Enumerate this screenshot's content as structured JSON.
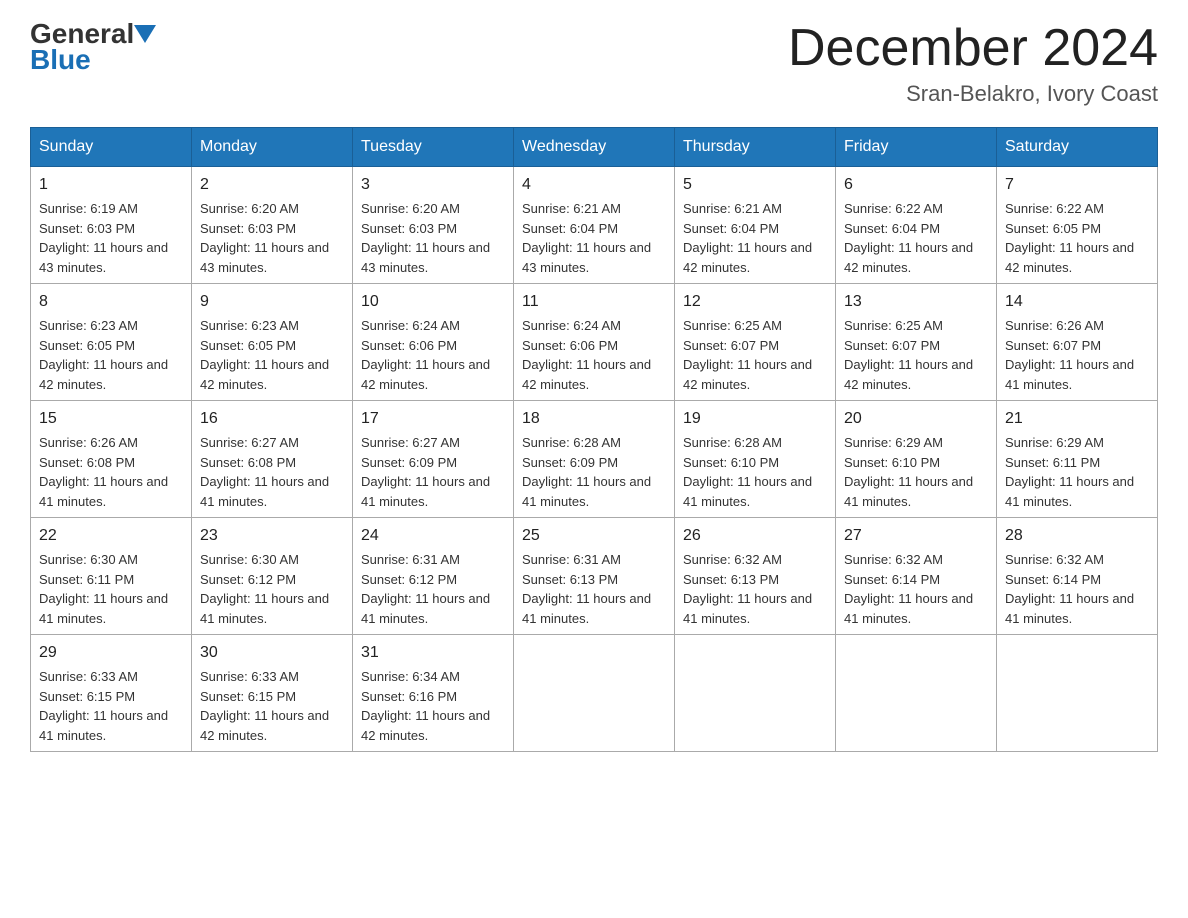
{
  "logo": {
    "part1": "General",
    "part2": "Blue"
  },
  "title": "December 2024",
  "location": "Sran-Belakro, Ivory Coast",
  "days_of_week": [
    "Sunday",
    "Monday",
    "Tuesday",
    "Wednesday",
    "Thursday",
    "Friday",
    "Saturday"
  ],
  "weeks": [
    [
      {
        "day": "1",
        "sunrise": "6:19 AM",
        "sunset": "6:03 PM",
        "daylight": "11 hours and 43 minutes."
      },
      {
        "day": "2",
        "sunrise": "6:20 AM",
        "sunset": "6:03 PM",
        "daylight": "11 hours and 43 minutes."
      },
      {
        "day": "3",
        "sunrise": "6:20 AM",
        "sunset": "6:03 PM",
        "daylight": "11 hours and 43 minutes."
      },
      {
        "day": "4",
        "sunrise": "6:21 AM",
        "sunset": "6:04 PM",
        "daylight": "11 hours and 43 minutes."
      },
      {
        "day": "5",
        "sunrise": "6:21 AM",
        "sunset": "6:04 PM",
        "daylight": "11 hours and 42 minutes."
      },
      {
        "day": "6",
        "sunrise": "6:22 AM",
        "sunset": "6:04 PM",
        "daylight": "11 hours and 42 minutes."
      },
      {
        "day": "7",
        "sunrise": "6:22 AM",
        "sunset": "6:05 PM",
        "daylight": "11 hours and 42 minutes."
      }
    ],
    [
      {
        "day": "8",
        "sunrise": "6:23 AM",
        "sunset": "6:05 PM",
        "daylight": "11 hours and 42 minutes."
      },
      {
        "day": "9",
        "sunrise": "6:23 AM",
        "sunset": "6:05 PM",
        "daylight": "11 hours and 42 minutes."
      },
      {
        "day": "10",
        "sunrise": "6:24 AM",
        "sunset": "6:06 PM",
        "daylight": "11 hours and 42 minutes."
      },
      {
        "day": "11",
        "sunrise": "6:24 AM",
        "sunset": "6:06 PM",
        "daylight": "11 hours and 42 minutes."
      },
      {
        "day": "12",
        "sunrise": "6:25 AM",
        "sunset": "6:07 PM",
        "daylight": "11 hours and 42 minutes."
      },
      {
        "day": "13",
        "sunrise": "6:25 AM",
        "sunset": "6:07 PM",
        "daylight": "11 hours and 42 minutes."
      },
      {
        "day": "14",
        "sunrise": "6:26 AM",
        "sunset": "6:07 PM",
        "daylight": "11 hours and 41 minutes."
      }
    ],
    [
      {
        "day": "15",
        "sunrise": "6:26 AM",
        "sunset": "6:08 PM",
        "daylight": "11 hours and 41 minutes."
      },
      {
        "day": "16",
        "sunrise": "6:27 AM",
        "sunset": "6:08 PM",
        "daylight": "11 hours and 41 minutes."
      },
      {
        "day": "17",
        "sunrise": "6:27 AM",
        "sunset": "6:09 PM",
        "daylight": "11 hours and 41 minutes."
      },
      {
        "day": "18",
        "sunrise": "6:28 AM",
        "sunset": "6:09 PM",
        "daylight": "11 hours and 41 minutes."
      },
      {
        "day": "19",
        "sunrise": "6:28 AM",
        "sunset": "6:10 PM",
        "daylight": "11 hours and 41 minutes."
      },
      {
        "day": "20",
        "sunrise": "6:29 AM",
        "sunset": "6:10 PM",
        "daylight": "11 hours and 41 minutes."
      },
      {
        "day": "21",
        "sunrise": "6:29 AM",
        "sunset": "6:11 PM",
        "daylight": "11 hours and 41 minutes."
      }
    ],
    [
      {
        "day": "22",
        "sunrise": "6:30 AM",
        "sunset": "6:11 PM",
        "daylight": "11 hours and 41 minutes."
      },
      {
        "day": "23",
        "sunrise": "6:30 AM",
        "sunset": "6:12 PM",
        "daylight": "11 hours and 41 minutes."
      },
      {
        "day": "24",
        "sunrise": "6:31 AM",
        "sunset": "6:12 PM",
        "daylight": "11 hours and 41 minutes."
      },
      {
        "day": "25",
        "sunrise": "6:31 AM",
        "sunset": "6:13 PM",
        "daylight": "11 hours and 41 minutes."
      },
      {
        "day": "26",
        "sunrise": "6:32 AM",
        "sunset": "6:13 PM",
        "daylight": "11 hours and 41 minutes."
      },
      {
        "day": "27",
        "sunrise": "6:32 AM",
        "sunset": "6:14 PM",
        "daylight": "11 hours and 41 minutes."
      },
      {
        "day": "28",
        "sunrise": "6:32 AM",
        "sunset": "6:14 PM",
        "daylight": "11 hours and 41 minutes."
      }
    ],
    [
      {
        "day": "29",
        "sunrise": "6:33 AM",
        "sunset": "6:15 PM",
        "daylight": "11 hours and 41 minutes."
      },
      {
        "day": "30",
        "sunrise": "6:33 AM",
        "sunset": "6:15 PM",
        "daylight": "11 hours and 42 minutes."
      },
      {
        "day": "31",
        "sunrise": "6:34 AM",
        "sunset": "6:16 PM",
        "daylight": "11 hours and 42 minutes."
      },
      null,
      null,
      null,
      null
    ]
  ],
  "labels": {
    "sunrise": "Sunrise:",
    "sunset": "Sunset:",
    "daylight": "Daylight:"
  }
}
